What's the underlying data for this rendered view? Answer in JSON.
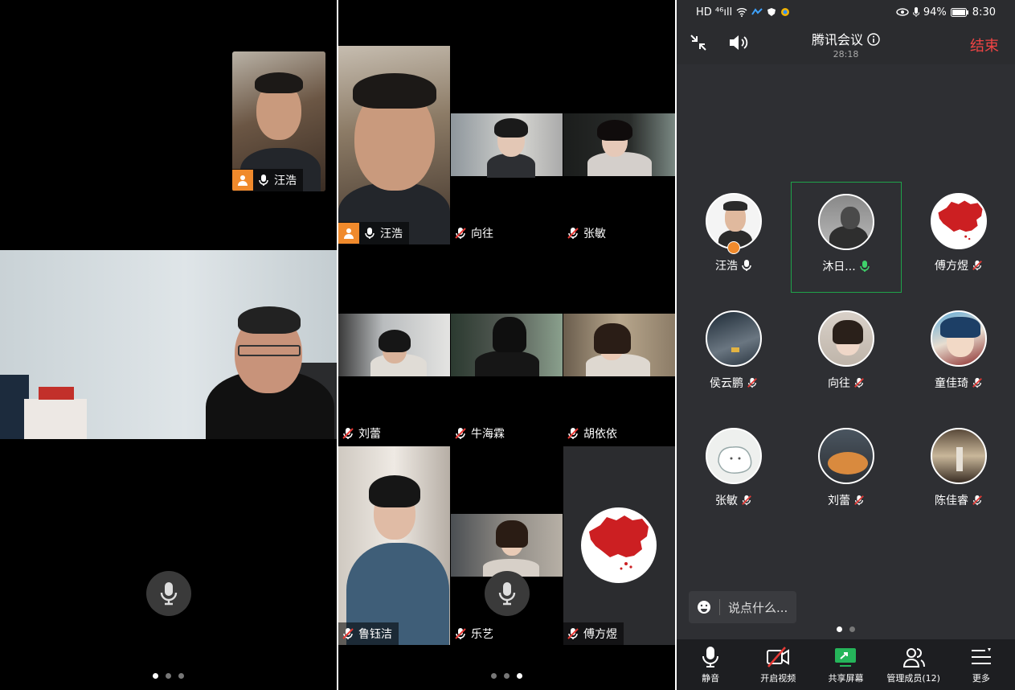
{
  "panel1": {
    "tiles": [
      {
        "name": "汪浩",
        "host": true,
        "mic": "on"
      }
    ],
    "pager": {
      "count": 3,
      "active": 0
    }
  },
  "panel2": {
    "tiles": [
      {
        "name": "汪浩",
        "host": true,
        "mic": "on"
      },
      {
        "name": "向往",
        "mic": "muted"
      },
      {
        "name": "张敏",
        "mic": "muted"
      },
      {
        "name": "刘蕾",
        "mic": "muted"
      },
      {
        "name": "牛海霖",
        "mic": "muted"
      },
      {
        "name": "胡依依",
        "mic": "muted"
      },
      {
        "name": "鲁钰洁",
        "mic": "muted"
      },
      {
        "name": "乐艺",
        "mic": "muted"
      },
      {
        "name": "傅方煜",
        "mic": "muted"
      }
    ],
    "pager": {
      "count": 3,
      "active": 2
    }
  },
  "status_bar": {
    "left": "HD ⁴⁶ıll",
    "battery": "94%",
    "time": "8:30"
  },
  "meeting": {
    "title": "腾讯会议",
    "duration": "28:18",
    "end_label": "结束"
  },
  "members": [
    {
      "name": "汪浩",
      "mic": "on",
      "host": true
    },
    {
      "name": "沐日...",
      "mic": "speaking",
      "active": true
    },
    {
      "name": "傅方煜",
      "mic": "muted"
    },
    {
      "name": "侯云鹏",
      "mic": "muted"
    },
    {
      "name": "向往",
      "mic": "muted"
    },
    {
      "name": "童佳琦",
      "mic": "muted"
    },
    {
      "name": "张敏",
      "mic": "muted"
    },
    {
      "name": "刘蕾",
      "mic": "muted"
    },
    {
      "name": "陈佳睿",
      "mic": "muted"
    }
  ],
  "chat_placeholder": "说点什么...",
  "panel3_pager": {
    "count": 2,
    "active": 0
  },
  "toolbar": [
    {
      "label": "静音",
      "icon": "mic-icon"
    },
    {
      "label": "开启视频",
      "icon": "video-off-icon"
    },
    {
      "label": "共享屏幕",
      "icon": "share-screen-icon"
    },
    {
      "label": "管理成员(12)",
      "icon": "members-icon"
    },
    {
      "label": "更多",
      "icon": "more-icon"
    }
  ],
  "colors": {
    "accent": "#1fa34a",
    "end": "#f04444",
    "host_badge": "#f08a2c"
  }
}
